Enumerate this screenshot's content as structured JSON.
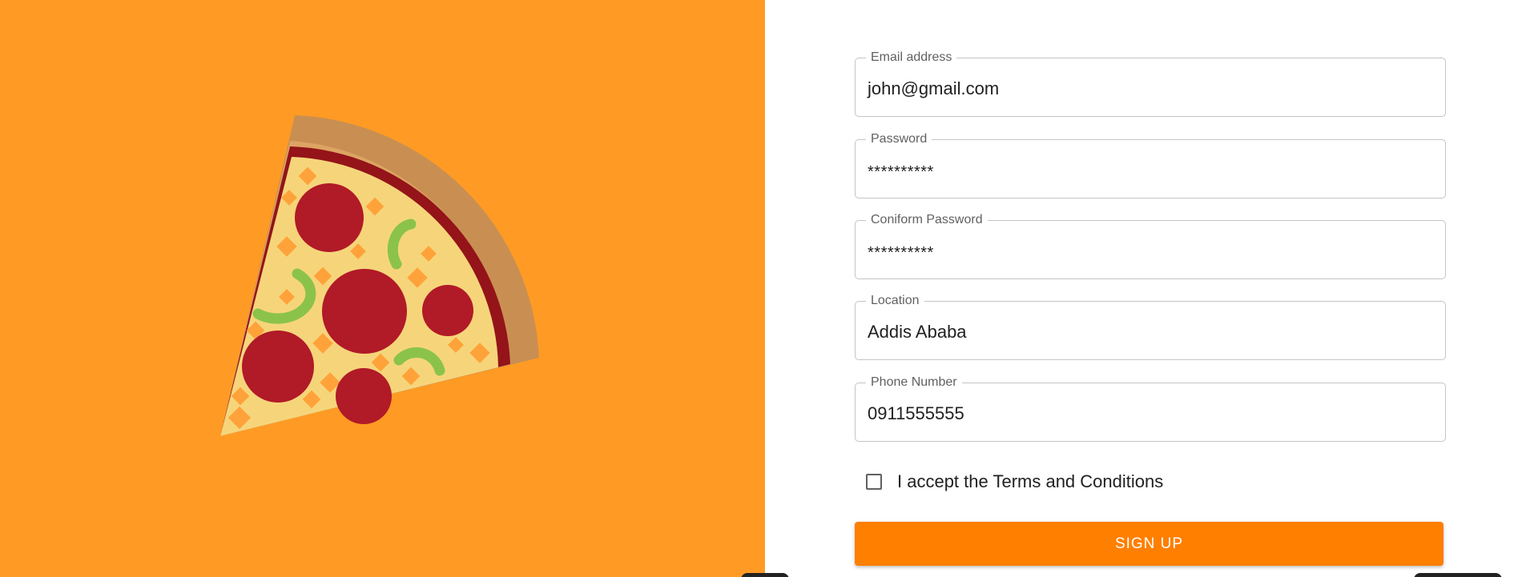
{
  "colors": {
    "left_background": "#FF9B24",
    "button_background": "#FF7F00",
    "border": "#c4c4c4"
  },
  "illustration": {
    "name": "pizza-slice-illustration"
  },
  "form": {
    "email": {
      "label": "Email address",
      "value": "john@gmail.com"
    },
    "password": {
      "label": "Password",
      "value": "**********"
    },
    "confirm_password": {
      "label": "Coniform Password",
      "value": "**********"
    },
    "location": {
      "label": "Location",
      "value": "Addis Ababa"
    },
    "phone": {
      "label": "Phone Number",
      "value": "0911555555"
    },
    "terms": {
      "label": "I accept the Terms and Conditions",
      "checked": false
    },
    "submit_label": "SIGN UP"
  }
}
